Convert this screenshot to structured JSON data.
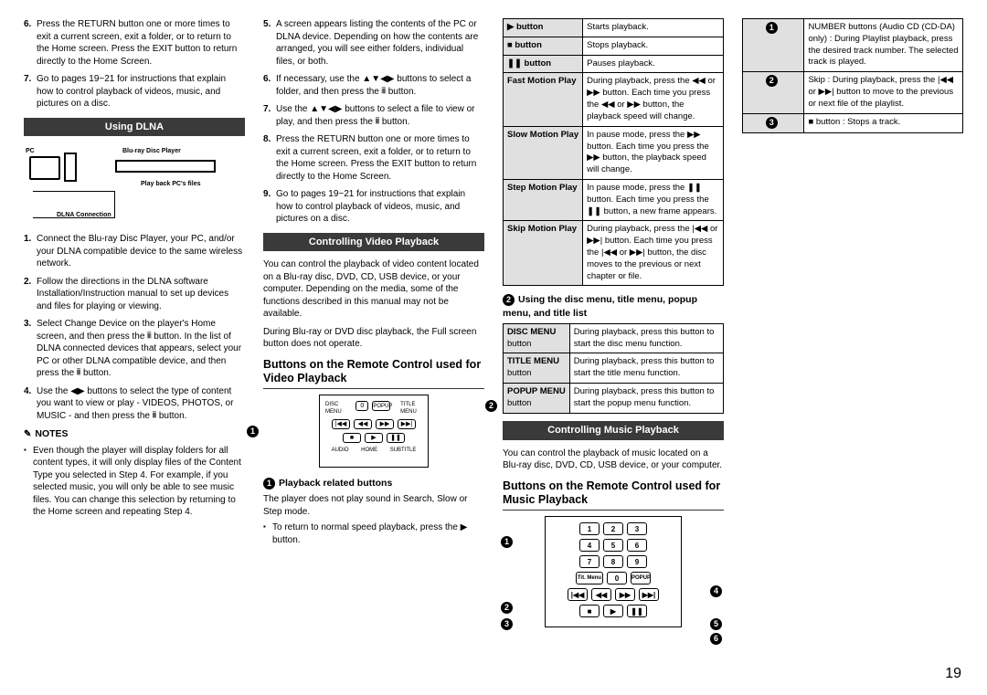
{
  "page_number": "19",
  "col1": {
    "steps_a": [
      {
        "n": "6.",
        "t": "Press the RETURN button one or more times to exit a current screen, exit a folder, or to return to the Home screen. Press the EXIT button to return directly to the Home Screen."
      },
      {
        "n": "7.",
        "t": "Go to pages 19~21 for instructions that explain how to control playback of videos, music, and pictures on a disc."
      }
    ],
    "using_dlna": "Using DLNA",
    "dlna_labels": {
      "pc": "PC",
      "bdp": "Blu-ray Disc Player",
      "files": "Play back PC's files",
      "conn": "DLNA Connection"
    },
    "steps_b": [
      {
        "n": "1.",
        "t": "Connect the Blu-ray Disc Player, your PC, and/or your DLNA compatible device to the same wireless network."
      },
      {
        "n": "2.",
        "t": "Follow the directions in the DLNA software Installation/Instruction manual to set up devices and files for playing or viewing."
      },
      {
        "n": "3.",
        "t": "Select Change Device on the player's Home screen, and then press the 𝄝 button. In the list of DLNA connected devices that appears, select your PC or other DLNA compatible device, and then press the 𝄝 button."
      },
      {
        "n": "4.",
        "t": "Use the ◀▶ buttons to select the type of content you want to view or play - VIDEOS, PHOTOS, or MUSIC - and then press the 𝄝 button."
      }
    ]
  },
  "col2": {
    "notes_title": "NOTES",
    "note_bullet": "Even though the player will display folders for all content types, it will only display files of the Content Type you selected in Step 4. For example, if you selected music, you will only be able to see music files. You can change this selection by returning to the Home screen and repeating Step 4.",
    "steps": [
      {
        "n": "5.",
        "t": "A screen appears listing the contents of the PC or DLNA device. Depending on how the contents are arranged, you will see either folders, individual files, or both."
      },
      {
        "n": "6.",
        "t": "If necessary, use the ▲▼◀▶ buttons to select a folder, and then press the 𝄝 button."
      },
      {
        "n": "7.",
        "t": "Use the ▲▼◀▶ buttons to select a file to view or play, and then press the 𝄝 button."
      },
      {
        "n": "8.",
        "t": "Press the RETURN button one or more times to exit a current screen, exit a folder, or to return to the Home screen. Press the EXIT button to return directly to the Home Screen."
      },
      {
        "n": "9.",
        "t": "Go to pages 19~21 for instructions that explain how to control playback of videos, music, and pictures on a disc."
      }
    ],
    "cvp": "Controlling Video Playback",
    "cvp_para1": "You can control the playback of video content located on a Blu-ray disc, DVD, CD, USB device, or your computer. Depending on the media, some of the functions described in this manual may not be available.",
    "cvp_para2": "During Blu-ray or DVD disc playback, the Full screen button does not operate."
  },
  "col3": {
    "heading": "Buttons on the Remote Control used for Video Playback",
    "remote_labels": {
      "disc": "DISC MENU",
      "title": "TITLE MENU",
      "popup": "POPUP",
      "audio": "AUDIO",
      "home": "HOME",
      "sub": "SUBTITLE",
      "zero": "0"
    },
    "sub1": "Playback related buttons",
    "sub1_para": "The player does not play sound in Search, Slow or Step mode.",
    "sub1_bullet": "To return to normal speed playback, press the ▶ button.",
    "playback_table": [
      {
        "k": "▶ button",
        "v": "Starts playback."
      },
      {
        "k": "■ button",
        "v": "Stops playback."
      },
      {
        "k": "❚❚ button",
        "v": "Pauses playback."
      },
      {
        "k": "Fast Motion Play",
        "v": "During playback, press the ◀◀ or ▶▶ button. Each time you press the ◀◀ or ▶▶ button, the playback speed will change."
      },
      {
        "k": "Slow Motion Play",
        "v": "In pause mode, press the ▶▶ button. Each time you press the ▶▶ button, the playback speed will change."
      },
      {
        "k": "Step Motion Play",
        "v": "In pause mode, press the ❚❚ button. Each time you press the ❚❚ button, a new frame appears."
      },
      {
        "k": "Skip Motion Play",
        "v": "During playback, press the |◀◀ or ▶▶| button. Each time you press the |◀◀ or ▶▶| button, the disc moves to the previous or next chapter or file."
      }
    ]
  },
  "col4": {
    "sub2": "Using the disc menu, title menu, popup menu, and title list",
    "menu_table": [
      {
        "k": "DISC MENU",
        "k2": "button",
        "v": "During playback, press this button to start the disc menu function."
      },
      {
        "k": "TITLE MENU",
        "k2": "button",
        "v": "During playback, press this button to start the title menu function."
      },
      {
        "k": "POPUP MENU",
        "k2": "button",
        "v": "During playback, press this button to start the popup menu function."
      }
    ],
    "cmp": "Controlling Music Playback",
    "cmp_para": "You can control the playback of music located on a Blu-ray disc, DVD, CD, USB device, or your computer.",
    "heading2": "Buttons on the Remote Control used for Music Playback",
    "music_table": [
      {
        "n": "1",
        "v": "NUMBER buttons (Audio CD (CD-DA) only) : During Playlist playback, press the desired track number. The selected track is played."
      },
      {
        "n": "2",
        "v": "Skip : During playback, press the |◀◀ or ▶▶| button to move to the previous or next file of the playlist."
      },
      {
        "n": "3",
        "v": "■ button : Stops a track."
      }
    ]
  }
}
